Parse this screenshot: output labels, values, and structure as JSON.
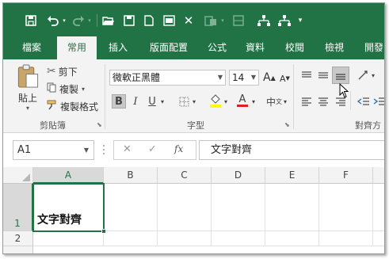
{
  "qat": {
    "icons": [
      "save-icon",
      "undo-icon",
      "redo-icon",
      "open-folder-icon",
      "save-as-icon",
      "new-doc-icon",
      "print-preview-icon",
      "close-icon",
      "paste-special-icon",
      "org-chart-icon",
      "org-chart-2-icon"
    ]
  },
  "tabs": [
    "檔案",
    "常用",
    "插入",
    "版面配置",
    "公式",
    "資料",
    "校閱",
    "檢視",
    "開發"
  ],
  "ribbon": {
    "clipboard": {
      "paste": "貼上",
      "cut": "剪下",
      "copy": "複製",
      "format_painter": "複製格式",
      "group_label": "剪貼簿"
    },
    "font": {
      "font_name": "微軟正黑體",
      "font_size": "14",
      "grow_label": "A",
      "shrink_label": "A",
      "bold": "B",
      "italic": "I",
      "underline": "U",
      "font_color_label": "A",
      "phonetic": "中",
      "group_label": "字型"
    },
    "alignment": {
      "group_label": "對齊方"
    }
  },
  "formula_bar": {
    "name_box": "A1",
    "cancel": "✕",
    "enter": "✓",
    "fx": "fx",
    "content": "文字對齊"
  },
  "grid": {
    "columns": [
      "A",
      "B",
      "C",
      "D",
      "E",
      "F"
    ],
    "rows": [
      "1",
      "2"
    ],
    "a1": "文字對齊"
  },
  "colors": {
    "accent": "#217346",
    "fill_highlight": "#ffff00",
    "font_red": "#e02020"
  }
}
